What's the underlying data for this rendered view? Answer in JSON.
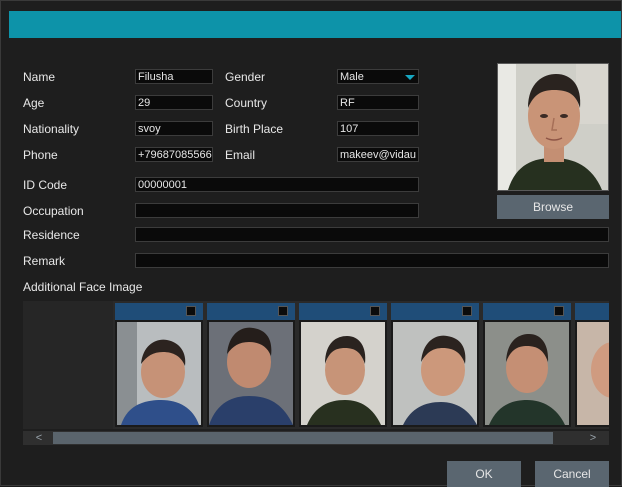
{
  "form": {
    "name_label": "Name",
    "name_value": "Filusha",
    "gender_label": "Gender",
    "gender_value": "Male",
    "age_label": "Age",
    "age_value": "29",
    "country_label": "Country",
    "country_value": "RF",
    "nationality_label": "Nationality",
    "nationality_value": "svoy",
    "birthplace_label": "Birth Place",
    "birthplace_value": "107",
    "phone_label": "Phone",
    "phone_value": "+79687085566",
    "email_label": "Email",
    "email_value": "makeev@vidau",
    "idcode_label": "ID Code",
    "idcode_value": "00000001",
    "occupation_label": "Occupation",
    "occupation_value": "",
    "residence_label": "Residence",
    "residence_value": "",
    "remark_label": "Remark",
    "remark_value": ""
  },
  "photo": {
    "browse_label": "Browse"
  },
  "gallery": {
    "title": "Additional Face Image",
    "scroll_left": "<",
    "scroll_right": ">",
    "scroll_position": 0.0
  },
  "buttons": {
    "ok_label": "OK",
    "cancel_label": "Cancel"
  },
  "colors": {
    "title_bar": "#0d93a9",
    "thumb_header": "#1f4d78",
    "button": "#5a6670"
  }
}
